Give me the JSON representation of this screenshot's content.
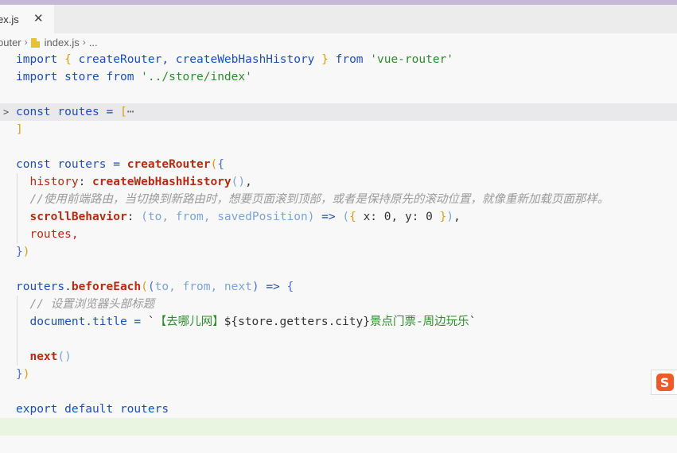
{
  "tab": {
    "label": "ex.js",
    "close": "✕"
  },
  "breadcrumb": {
    "folder": "outer",
    "file": "index.js",
    "more": "..."
  },
  "code": {
    "l1": {
      "import": "import",
      "lb": "{",
      "names": "createRouter, createWebHashHistory",
      "rb": "}",
      "from": "from",
      "mod": "'vue-router'"
    },
    "l2": {
      "import": "import",
      "name": "store",
      "from": "from",
      "mod": "'../store/index'"
    },
    "l4": {
      "const": "const",
      "name": "routes",
      "eq": "=",
      "lb": "[",
      "ellipsis": "⋯"
    },
    "l5": {
      "rb": "]"
    },
    "l7": {
      "const": "const",
      "name": "routers",
      "eq": "=",
      "fn": "createRouter",
      "lp": "(",
      "lb": "{"
    },
    "l8": {
      "key": "history",
      "fn": "createWebHashHistory",
      "parens": "()",
      "comma": ","
    },
    "l9": {
      "comment": "//使用前端路由，当切换到新路由时，想要页面滚到顶部，或者是保持原先的滚动位置，就像重新加载页面那样。"
    },
    "l10": {
      "key": "scrollBehavior",
      "lp": "(",
      "params": "to, from, savedPosition",
      "rp": ")",
      "arrow": "=>",
      "lp2": "(",
      "lb": "{",
      "body": "x: 0, y: 0",
      "rb": "}",
      "rp2": ")",
      "comma": ","
    },
    "l11": {
      "text": "routes,"
    },
    "l12": {
      "rb": "}",
      "rp": ")"
    },
    "l14": {
      "obj": "routers",
      "dot": ".",
      "fn": "beforeEach",
      "lp": "(",
      "lp2": "(",
      "params": "to, from, next",
      "rp2": ")",
      "arrow": "=>",
      "lb": "{"
    },
    "l15": {
      "comment": "// 设置浏览器头部标题"
    },
    "l16": {
      "lhs": "document.title =",
      "tick": "`",
      "cn": "【去哪儿网】",
      "expr": "${store.getters.city}",
      "cn2": "景点门票-周边玩乐",
      "tick2": "`"
    },
    "l18": {
      "fn": "next",
      "parens": "()"
    },
    "l19": {
      "rb": "}",
      "rp": ")"
    },
    "l21": {
      "text": "export default routers"
    }
  },
  "sogou": {
    "label": "S"
  }
}
